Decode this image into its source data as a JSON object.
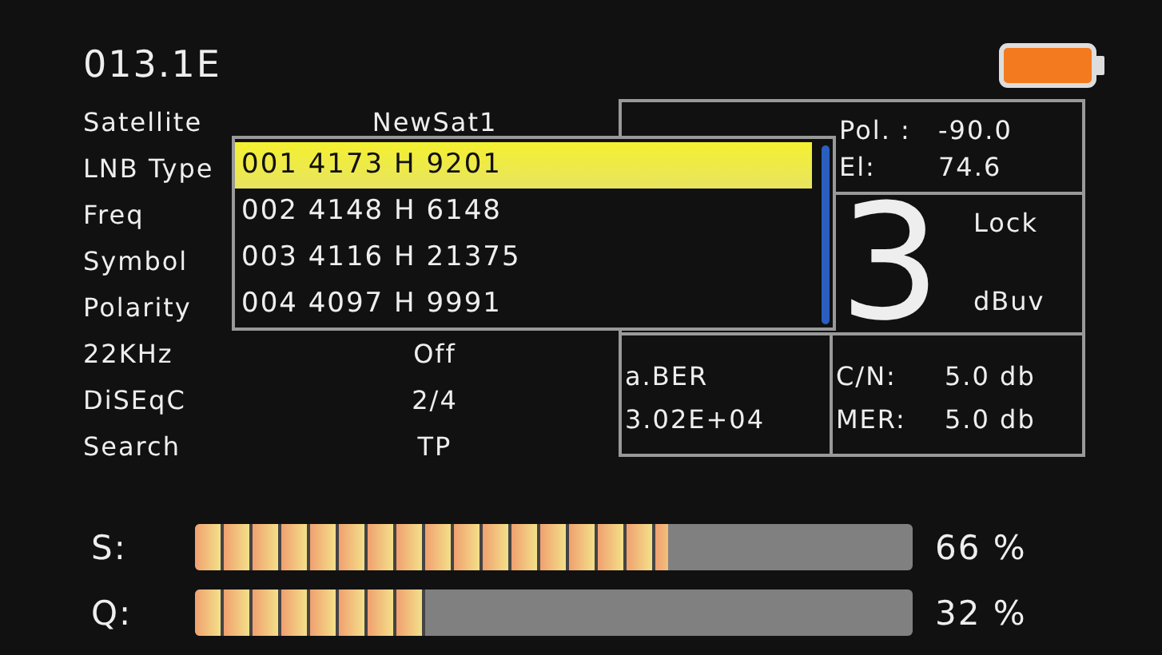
{
  "title": "013.1E",
  "params": [
    {
      "label": "Satellite",
      "value": "NewSat1"
    },
    {
      "label": "LNB Type"
    },
    {
      "label": "Freq"
    },
    {
      "label": "Symbol"
    },
    {
      "label": "Polarity"
    },
    {
      "label": "22KHz",
      "value": "Off"
    },
    {
      "label": "DiSEqC",
      "value": "2/4"
    },
    {
      "label": "Search",
      "value": "TP"
    }
  ],
  "tp_list": [
    {
      "text": "001 4173 H 9201",
      "selected": true
    },
    {
      "text": "002 4148 H 6148",
      "selected": false
    },
    {
      "text": "003 4116 H 21375",
      "selected": false
    },
    {
      "text": "004 4097 H 9991",
      "selected": false
    }
  ],
  "antenna": [
    {
      "label": "Pol. :",
      "value": "-90.0"
    },
    {
      "label": "El:",
      "value": "74.6"
    }
  ],
  "level": {
    "value": "3",
    "status": "Lock",
    "unit": "dBuv"
  },
  "ber": {
    "label": "a.BER",
    "value": "3.02E+04"
  },
  "readings": [
    {
      "label": "C/N:",
      "value": "5.0 db"
    },
    {
      "label": "MER:",
      "value": "5.0 db"
    }
  ],
  "meters": [
    {
      "label": "S:",
      "level": 0.66,
      "reading": "66 %"
    },
    {
      "label": "Q:",
      "level": 0.32,
      "reading": "32 %"
    }
  ]
}
